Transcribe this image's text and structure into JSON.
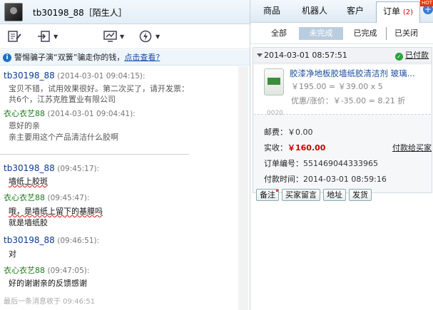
{
  "header": {
    "contact": "tb30198_88［陌生人］"
  },
  "toolbar": {
    "icons": [
      "edit-icon",
      "transfer-icon",
      "monitor-icon",
      "alert-icon"
    ]
  },
  "warning": {
    "text": "警惕骗子演“双簧”骗走你的钱，",
    "link": "点击查看?"
  },
  "messages": [
    {
      "user": "tb30198_88",
      "time": "(2014-03-01 09:04:15):",
      "lines": [
        "宝贝不错，试用效果很好。第二次买了，请开发票：",
        "共6个，江苏克胜置业有限公司"
      ]
    },
    {
      "user": "衣心衣艺88",
      "time": "(2014-03-01 09:04:41):",
      "lines": [
        "恩好的亲",
        "亲主要用这个产品清洁什么胶啊"
      ]
    },
    {
      "user": "tb30198_88",
      "time": "(09:45:17):",
      "lines": [
        "墙纸上胶斑"
      ]
    },
    {
      "user": "衣心衣艺88",
      "time": "(09:45:47):",
      "lines": [
        "哦，是墙纸上留下的基膜吗",
        "就是墙纸胶"
      ]
    },
    {
      "user": "tb30198_88",
      "time": "(09:46:51):",
      "lines": [
        "对"
      ]
    },
    {
      "user": "衣心衣艺88",
      "time": "(09:47:05):",
      "lines": [
        "好的谢谢亲的反馈感谢"
      ]
    }
  ],
  "footer": "最后一条消息收于 09:46:51",
  "right_tabs": [
    {
      "label": "商品"
    },
    {
      "label": "机器人"
    },
    {
      "label": "客户"
    },
    {
      "label": "订单",
      "count": "(2)"
    }
  ],
  "hot_badge": "HOT",
  "plus_icon": "+",
  "filters": [
    "全部",
    "未完成",
    "已完成",
    "已关闭"
  ],
  "order": {
    "datetime": "2014-03-01 08:57:51",
    "status": "已付款",
    "product_title": "胶漆净地板胶墙纸胶清洁剂 玻璃...",
    "price_line": "￥195.00 = ￥39.00 x 5",
    "discount_line": "优惠/涨价：￥-35.00 = 8.21 折",
    "product_code": "0020",
    "postage_label": "邮费：",
    "postage_value": "￥0.00",
    "paid_label": "实收：",
    "paid_value": "￥160.00",
    "pay_link": "付款给买家",
    "order_no_label": "订单编号：",
    "order_no": "551469044333965",
    "pay_time_label": "付款时间：",
    "pay_time": "2014-03-01 08:59:16",
    "buttons": [
      "备注",
      "买家留言",
      "地址",
      "发货"
    ]
  }
}
